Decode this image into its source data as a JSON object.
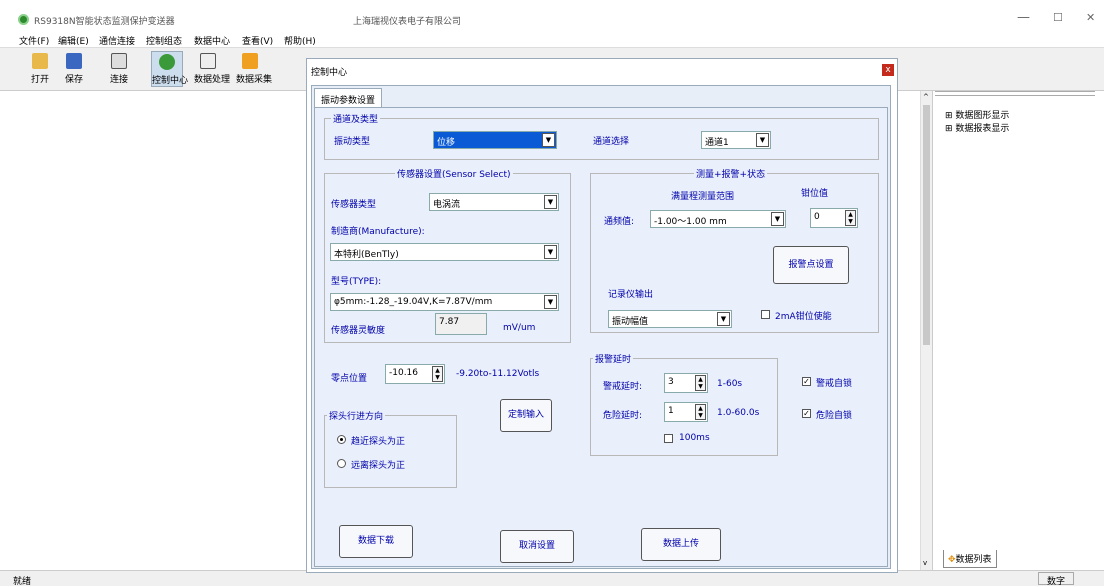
{
  "app": {
    "title": "RS9318N智能状态监测保护变送器",
    "company": "上海瑞视仪表电子有限公司",
    "window_controls": [
      "—",
      "☐",
      "✕"
    ]
  },
  "menu": [
    "文件(F)",
    "编辑(E)",
    "通信连接",
    "控制组态",
    "数据中心",
    "查看(V)",
    "帮助(H)"
  ],
  "toolbar": [
    "打开",
    "保存",
    "连接",
    "控制中心",
    "数据处理",
    "数据采集"
  ],
  "status": {
    "left": "就绪",
    "right": "数字"
  },
  "right_tree": [
    "数据图形显示",
    "数据报表显示"
  ],
  "right_tab": "数据列表",
  "dialog": {
    "title": "控制中心",
    "close": "x",
    "tab": "振动参数设置",
    "channel_group": {
      "title": "通道及类型",
      "type_label": "振动类型",
      "type_value": "位移",
      "channel_label": "通道选择",
      "channel_value": "通道1"
    },
    "sensor_group": {
      "title": "传感器设置(Sensor Select)",
      "type_label": "传感器类型",
      "type_value": "电涡流",
      "maker_label": "制造商(Manufacture):",
      "maker_value": "本特利(BenTly)",
      "model_label": "型号(TYPE):",
      "model_value": "φ5mm:-1.28_-19.04V,K=7.87V/mm",
      "sens_label": "传感器灵敏度",
      "sens_value": "7.87",
      "sens_unit": "mV/um"
    },
    "measure_group": {
      "title": "测量+报警+状态",
      "range_header": "满量程测量范围",
      "clamp_header": "钳位值",
      "freq_label": "通频值:",
      "freq_value": "-1.00～1.00 mm",
      "clamp_value": "0",
      "alarm_button": "报警点设置",
      "recorder_label": "记录仪输出",
      "recorder_value": "振动幅值",
      "clamp_enable": "2mA钳位使能"
    },
    "zero": {
      "label": "零点位置",
      "value": "-10.16",
      "range": "-9.20to-11.12Votls"
    },
    "direction_group": {
      "title": "探头行进方向",
      "opt1": "趋近探头为正",
      "opt2": "远离探头为正"
    },
    "custom_button": "定制输入",
    "delay_group": {
      "title": "报警延时",
      "warn_label": "警戒延时:",
      "warn_value": "3",
      "warn_range": "1-60s",
      "danger_label": "危险延时:",
      "danger_value": "1",
      "danger_range": "1.0-60.0s",
      "ms_label": "100ms"
    },
    "latch": {
      "warn": "警戒自锁",
      "danger": "危险自锁"
    },
    "buttons": {
      "download": "数据下载",
      "cancel": "取消设置",
      "upload": "数据上传"
    }
  },
  "colors": {
    "accent": "#0000aa",
    "selection": "#0a5ad6",
    "close": "#c42b1c"
  }
}
